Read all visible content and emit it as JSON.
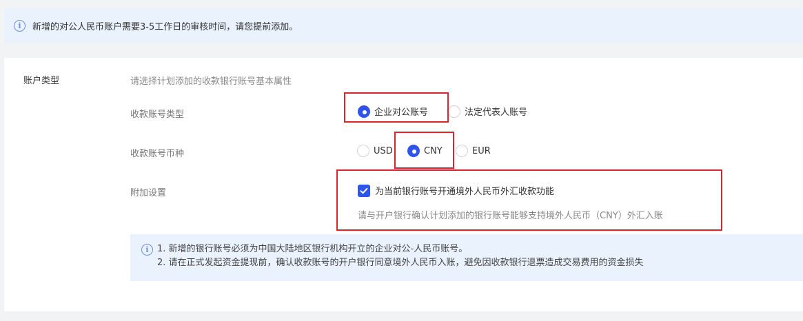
{
  "top_notice": {
    "icon": "info-icon",
    "text": "新增的对公人民币账户需要3-5工作日的审核时间，请您提前添加。"
  },
  "account_type": {
    "label": "账户类型",
    "hint": "请选择计划添加的收款银行账号基本属性"
  },
  "receive_account_type": {
    "label": "收款账号类型",
    "options": [
      "企业对公账号",
      "法定代表人账号"
    ],
    "selected": "企业对公账号"
  },
  "currency": {
    "label": "收款账号币种",
    "options": [
      "USD",
      "CNY",
      "EUR"
    ],
    "selected": "CNY"
  },
  "additional": {
    "label": "附加设置",
    "checkbox_label": "为当前银行账号开通境外人民币外汇收款功能",
    "checked": true,
    "hint": "请与开户银行确认计划添加的银行账号能够支持境外人民币（CNY）外汇入账"
  },
  "bottom_notice": {
    "icon": "info-icon",
    "lines": [
      "1. 新增的银行账号必须为中国大陆地区银行机构开立的企业对公-人民币账号。",
      "2. 请在正式发起资金提现前，确认收款账号的开户银行同意境外人民币入账，避免因收款银行退票造成交易费用的资金损失"
    ]
  },
  "colors": {
    "accent": "#2f54eb",
    "highlight_border": "#d9262c",
    "notice_bg": "#e9f2fd"
  }
}
